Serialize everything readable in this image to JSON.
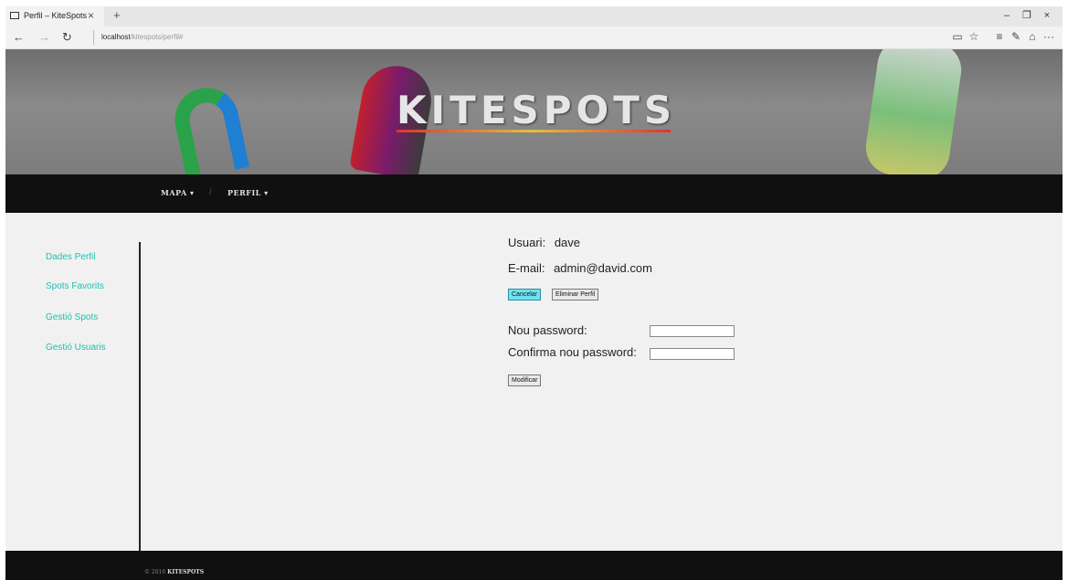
{
  "browser": {
    "tab_title": "Perfil – KiteSpots",
    "tab_close": "×",
    "new_tab": "+",
    "url_host": "localhost",
    "url_path": "/kitespots/perfil#",
    "back": "←",
    "forward": "→",
    "refresh": "↻",
    "minimize": "–",
    "restore": "❐",
    "close": "×",
    "reading_view": "▭",
    "favorite": "☆",
    "hub": "≡",
    "notes": "✎",
    "share": "⌂",
    "more": "···"
  },
  "banner": {
    "logo": "KITESPOTS"
  },
  "nav": {
    "mapa": "MAPA ▾",
    "separator": "/",
    "perfil": "PERFIL ▾"
  },
  "sidebar": {
    "items": [
      {
        "label": "Dades Perfil"
      },
      {
        "label": "Spots Favorits"
      },
      {
        "label": "Gestió Spots"
      },
      {
        "label": "Gestió Usuaris"
      }
    ]
  },
  "profile": {
    "user_label": "Usuari:",
    "user_value": "dave",
    "email_label": "E-mail:",
    "email_value": "admin@david.com",
    "cancel_label": "Cancelar",
    "delete_label": "Eliminar Perfil",
    "new_password_label": "Nou password:",
    "confirm_password_label": "Confirma nou password:",
    "modify_label": "Modificar"
  },
  "footer": {
    "copyright": "© 2016",
    "brand": "KITESPOTS"
  },
  "colors": {
    "accent": "#1fbfb0",
    "cancel_button": "#6fe2f0",
    "navbar": "#101010"
  }
}
